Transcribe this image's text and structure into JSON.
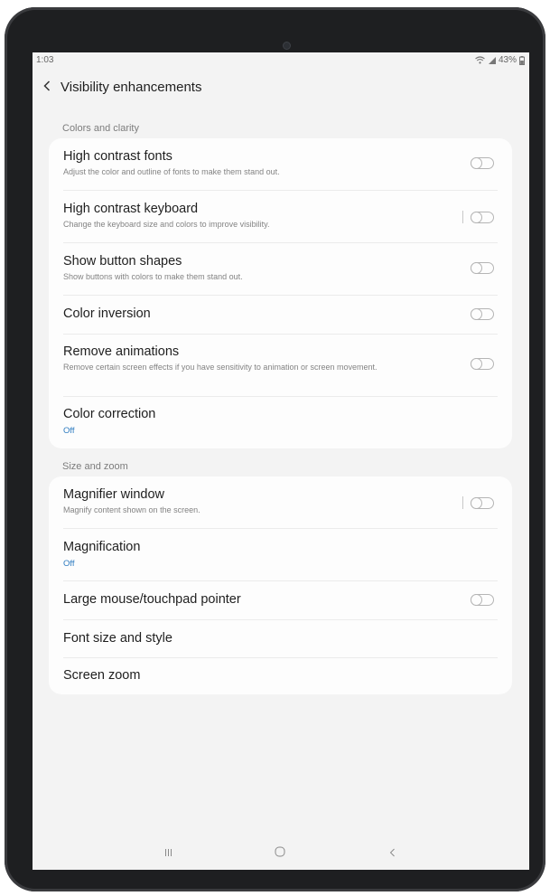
{
  "status": {
    "time": "1:03",
    "battery": "43%"
  },
  "header": {
    "title": "Visibility enhancements"
  },
  "sections": [
    {
      "header": "Colors and clarity",
      "items": [
        {
          "title": "High contrast fonts",
          "desc": "Adjust the color and outline of fonts to make them stand out.",
          "toggle": false
        },
        {
          "title": "High contrast keyboard",
          "desc": "Change the keyboard size and colors to improve visibility.",
          "toggle": false
        },
        {
          "title": "Show button shapes",
          "desc": "Show buttons with colors to make them stand out.",
          "toggle": false
        },
        {
          "title": "Color inversion",
          "toggle": false
        },
        {
          "title": "Remove animations",
          "desc": "Remove certain screen effects if you have sensitivity to animation or screen movement.",
          "toggle": false
        },
        {
          "title": "Color correction",
          "value": "Off"
        }
      ]
    },
    {
      "header": "Size and zoom",
      "items": [
        {
          "title": "Magnifier window",
          "desc": "Magnify content shown on the screen.",
          "toggle": false
        },
        {
          "title": "Magnification",
          "value": "Off"
        },
        {
          "title": "Large mouse/touchpad pointer",
          "toggle": false
        },
        {
          "title": "Font size and style"
        },
        {
          "title": "Screen zoom"
        }
      ]
    }
  ],
  "colors": {
    "accent": "#2d7bc0",
    "background": "#f3f3f3",
    "card": "#fdfdfd",
    "bezel": "#1e1f21"
  },
  "icons": {
    "back": "chevron-left-icon",
    "wifi": "wifi-icon",
    "signal": "signal-icon",
    "battery": "battery-icon",
    "recents": "recents-icon",
    "home": "home-icon",
    "nav_back": "back-icon"
  }
}
